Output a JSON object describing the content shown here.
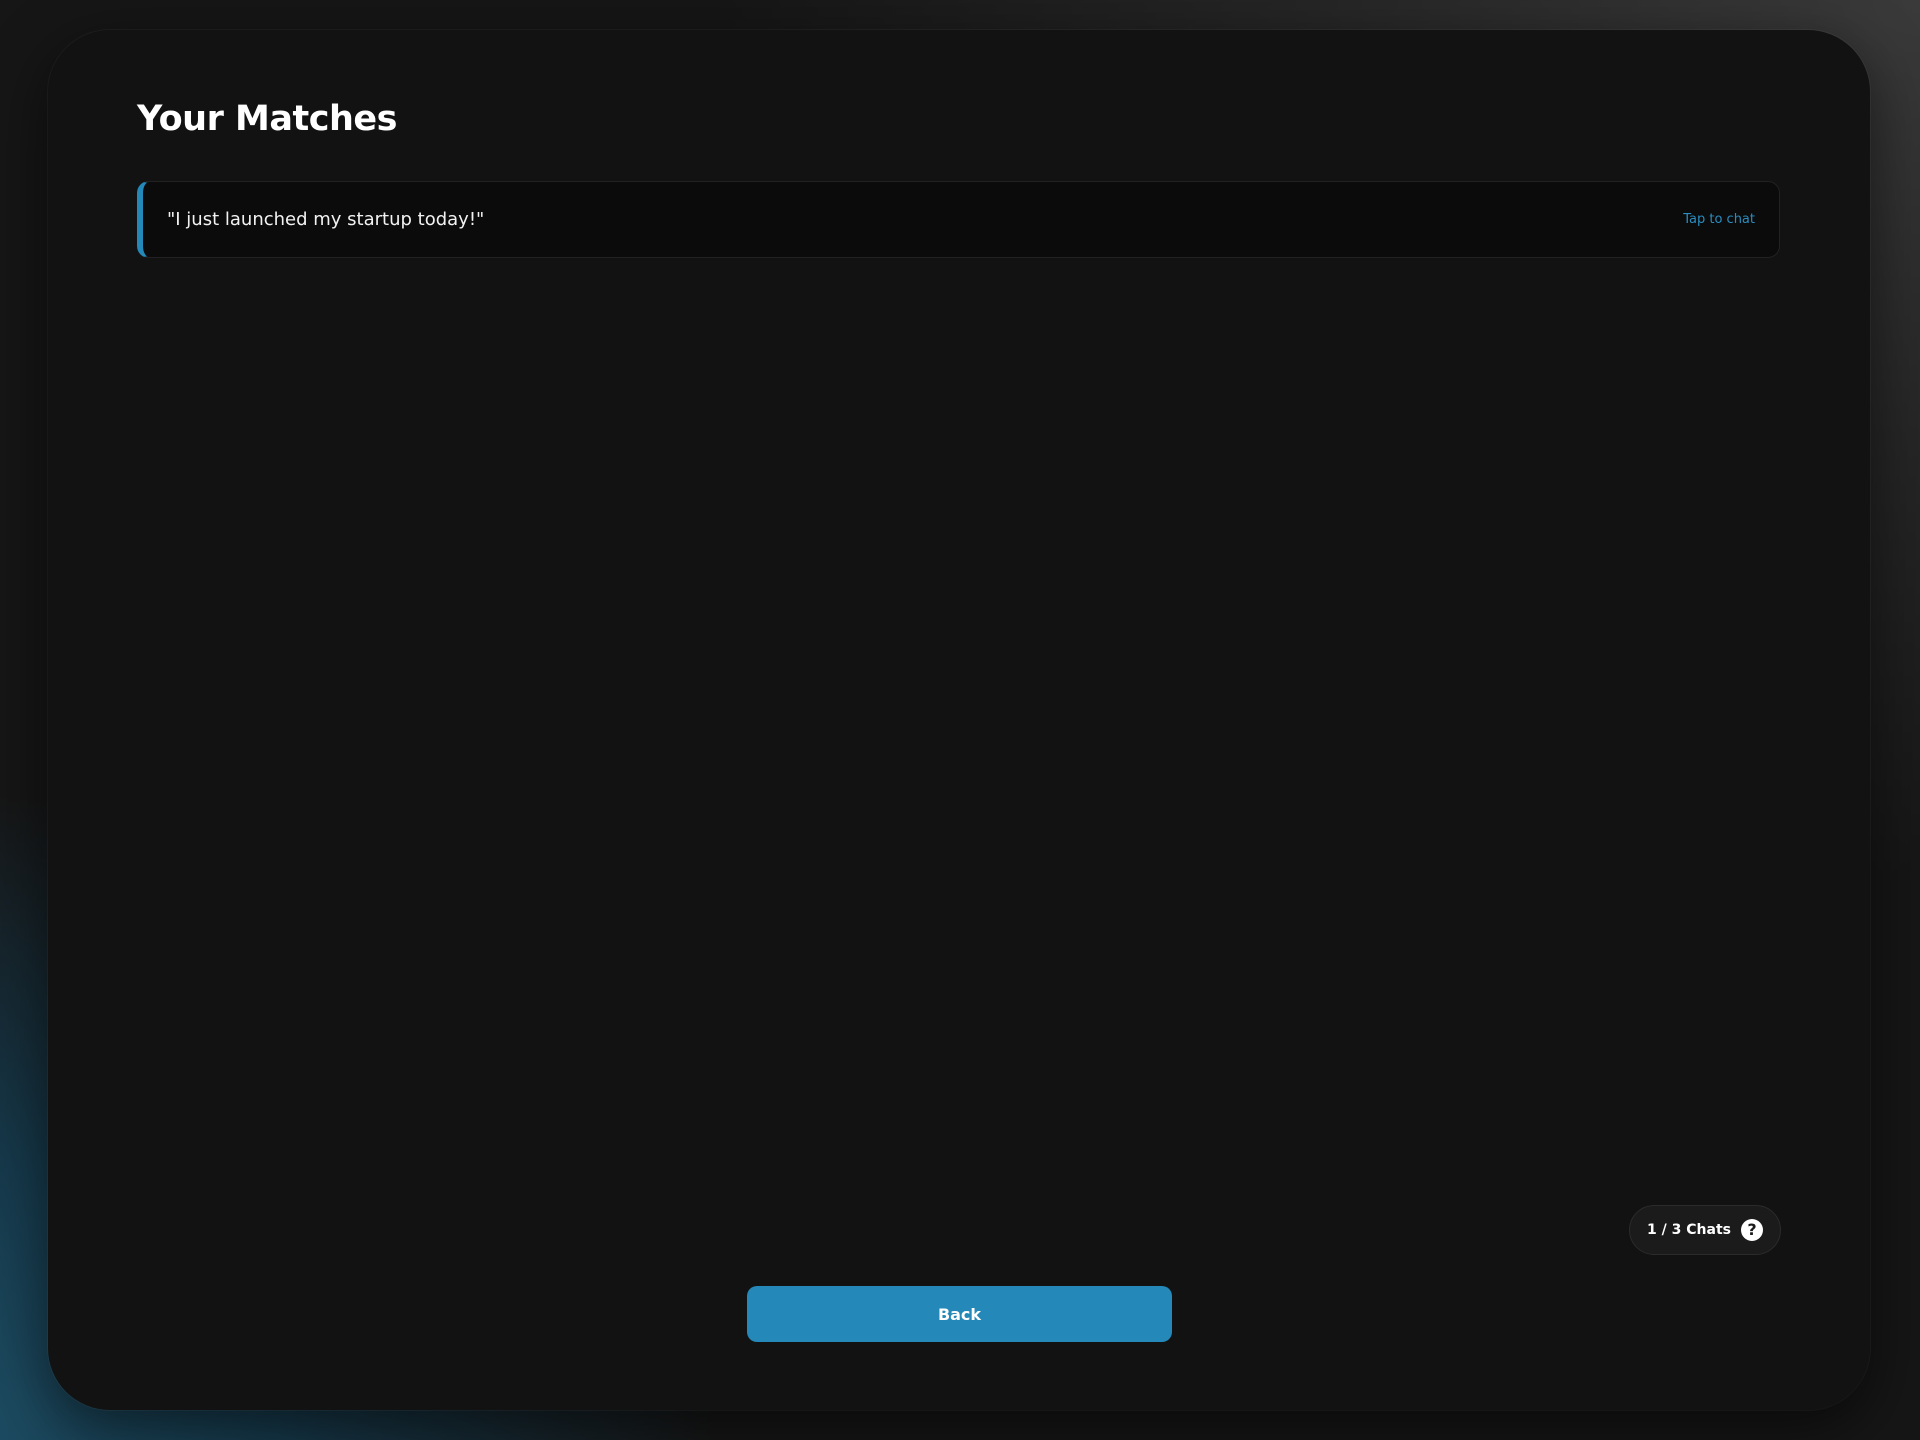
{
  "page": {
    "title": "Your Matches"
  },
  "matches": [
    {
      "quote": "\"I just launched my startup today!\"",
      "cta": "Tap to chat"
    }
  ],
  "chat_counter": {
    "label": "1 / 3 Chats",
    "used": 1,
    "limit": 3,
    "help_icon": "question-circle-icon"
  },
  "actions": {
    "back_label": "Back"
  },
  "colors": {
    "accent": "#2488b8",
    "panel_background": "#121212",
    "card_background": "#0b0b0b",
    "text_primary": "#ffffff",
    "link": "#2a8cc0"
  }
}
